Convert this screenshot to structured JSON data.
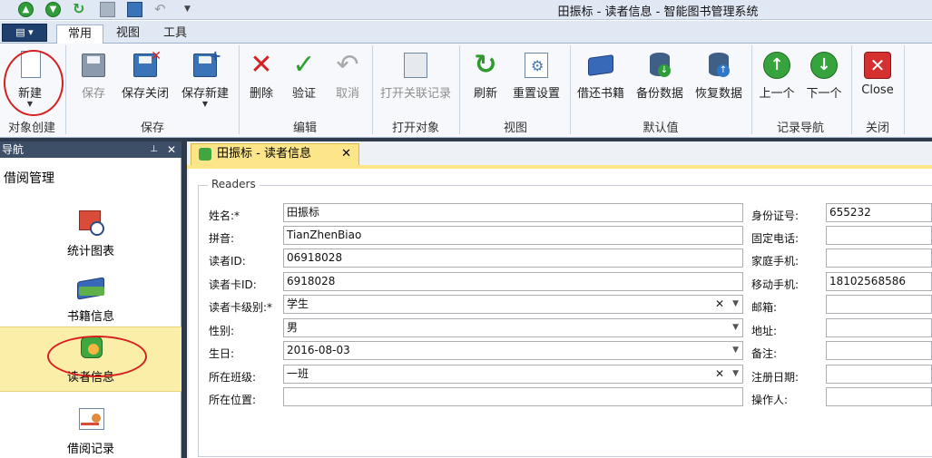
{
  "window": {
    "title": "田振标 - 读者信息 - 智能图书管理系统"
  },
  "tabs": [
    {
      "label": "常用"
    },
    {
      "label": "视图"
    },
    {
      "label": "工具"
    }
  ],
  "ribbon": {
    "buttons": {
      "new": "新建",
      "save": "保存",
      "save_close": "保存关闭",
      "save_new": "保存新建",
      "delete": "删除",
      "validate": "验证",
      "cancel": "取消",
      "open_related": "打开关联记录",
      "refresh": "刷新",
      "reset_settings": "重置设置",
      "borrow_return": "借还书籍",
      "backup": "备份数据",
      "restore": "恢复数据",
      "previous": "上一个",
      "next": "下一个",
      "close": "Close"
    },
    "groups": {
      "object_create": "对象创建",
      "save": "保存",
      "edit": "编辑",
      "open_object": "打开对象",
      "view": "视图",
      "defaults": "默认值",
      "record_nav": "记录导航",
      "close": "关闭"
    }
  },
  "nav": {
    "header": "导航",
    "group": "借阅管理",
    "items": [
      {
        "label": "统计图表"
      },
      {
        "label": "书籍信息"
      },
      {
        "label": "读者信息"
      },
      {
        "label": "借阅记录"
      }
    ]
  },
  "doc_tab": {
    "label": "田振标 - 读者信息"
  },
  "form": {
    "group_title": "Readers",
    "left": [
      {
        "label": "姓名:*",
        "value": "田振标"
      },
      {
        "label": "拼音:",
        "value": "TianZhenBiao"
      },
      {
        "label": "读者ID:",
        "value": "06918028"
      },
      {
        "label": "读者卡ID:",
        "value": "6918028"
      },
      {
        "label": "读者卡级别:*",
        "value": "学生"
      },
      {
        "label": "性别:",
        "value": "男"
      },
      {
        "label": "生日:",
        "value": "2016-08-03"
      },
      {
        "label": "所在班级:",
        "value": "一班"
      },
      {
        "label": "所在位置:",
        "value": ""
      }
    ],
    "right": [
      {
        "label": "身份证号:",
        "value": "655232"
      },
      {
        "label": "固定电话:",
        "value": ""
      },
      {
        "label": "家庭手机:",
        "value": ""
      },
      {
        "label": "移动手机:",
        "value": "18102568586"
      },
      {
        "label": "邮箱:",
        "value": ""
      },
      {
        "label": "地址:",
        "value": ""
      },
      {
        "label": "备注:",
        "value": ""
      },
      {
        "label": "注册日期:",
        "value": ""
      },
      {
        "label": "操作人:",
        "value": ""
      }
    ]
  }
}
